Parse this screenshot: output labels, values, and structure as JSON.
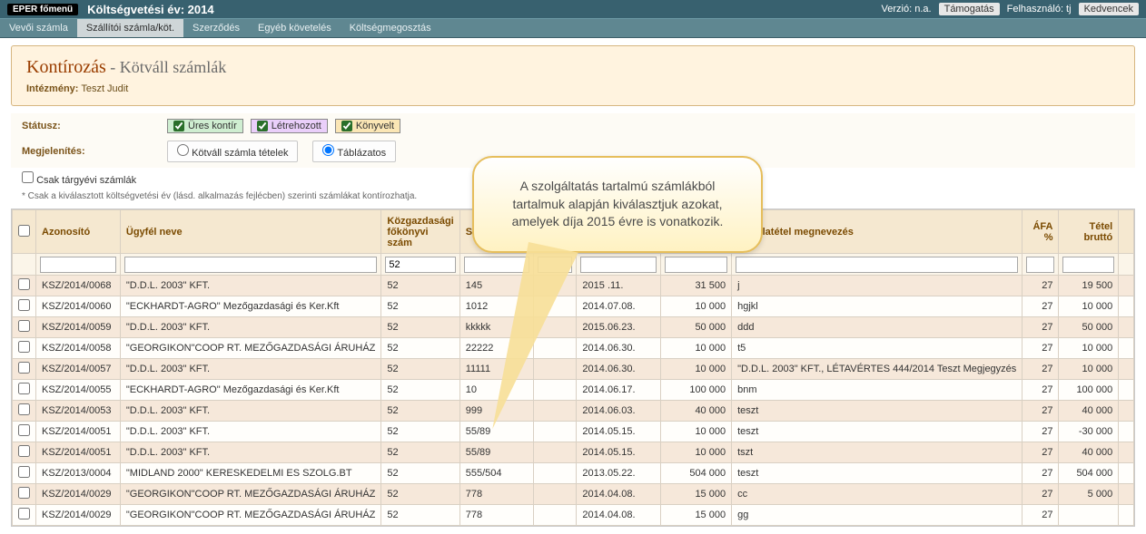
{
  "topbar": {
    "brand": "EPER főmenü",
    "year_label": "Költségvetési év: 2014",
    "verzio": "Verzió: n.a.",
    "tamogatas": "Támogatás",
    "user_label": "Felhasználó: tj",
    "favs": "Kedvencek"
  },
  "menu": [
    "Vevői számla",
    "Szállítói számla/köt.",
    "Szerződés",
    "Egyéb követelés",
    "Költségmegosztás"
  ],
  "panel": {
    "title": "Kontírozás",
    "subtitle": " - Kötváll számlák",
    "inst_label": "Intézmény:",
    "inst_value": "Teszt Judit"
  },
  "filters": {
    "status_label": "Státusz:",
    "st1": "Üres kontír",
    "st2": "Létrehozott",
    "st3": "Könyvelt",
    "display_label": "Megjelenítés:",
    "r1": "Kötváll számla tételek",
    "r2": "Táblázatos",
    "only_this_year": "Csak tárgyévi számlák",
    "note": "* Csak a kiválasztott költségvetési év (lásd. alkalmazás fejlécben) szerinti számlákat kontírozhatja."
  },
  "callout": "A szolgáltatás tartalmú számlákból tartalmuk alapján kiválasztjuk azokat, amelyek díja 2015 évre is vonatkozik.",
  "columns": {
    "id": "Azonosító",
    "client": "Ügyfél neve",
    "fk": "Közgazdasági főkönyvi szám",
    "szs": "Számla so",
    "d1": "",
    "d2": "",
    "num": "",
    "desc": "számlatétel megnevezés",
    "afa": "ÁFA %",
    "brutto": "Tétel bruttó"
  },
  "filter_row": {
    "fk": "52"
  },
  "rows": [
    {
      "id": "KSZ/2014/0068",
      "client": "\"D.D.L. 2003\" KFT.",
      "fk": "52",
      "szs": "145",
      "d1": "",
      "d2": "2015     .11.",
      "num": "31 500",
      "desc": "j",
      "afa": "27",
      "brutto": "19 500"
    },
    {
      "id": "KSZ/2014/0060",
      "client": "\"ECKHARDT-AGRO\" Mezőgazdasági és Ker.Kft",
      "fk": "52",
      "szs": "1012",
      "d1": "",
      "d2": "2014.07.08.",
      "num": "10 000",
      "desc": "hgjkl",
      "afa": "27",
      "brutto": "10 000"
    },
    {
      "id": "KSZ/2014/0059",
      "client": "\"D.D.L. 2003\" KFT.",
      "fk": "52",
      "szs": "kkkkk",
      "d1": "",
      "d2": "2015.06.23.",
      "num": "50 000",
      "desc": "ddd",
      "afa": "27",
      "brutto": "50 000"
    },
    {
      "id": "KSZ/2014/0058",
      "client": "\"GEORGIKON\"COOP RT. MEZŐGAZDASÁGI ÁRUHÁZ",
      "fk": "52",
      "szs": "22222",
      "d1": "",
      "d2": "2014.06.30.",
      "num": "10 000",
      "desc": "t5",
      "afa": "27",
      "brutto": "10 000"
    },
    {
      "id": "KSZ/2014/0057",
      "client": "\"D.D.L. 2003\" KFT.",
      "fk": "52",
      "szs": "11111",
      "d1": "",
      "d2": "2014.06.30.",
      "num": "10 000",
      "desc": "\"D.D.L. 2003\" KFT., LÉTAVÉRTES 444/2014 Teszt Megjegyzés",
      "afa": "27",
      "brutto": "10 000"
    },
    {
      "id": "KSZ/2014/0055",
      "client": "\"ECKHARDT-AGRO\" Mezőgazdasági és Ker.Kft",
      "fk": "52",
      "szs": "10",
      "d1": "",
      "d2": "2014.06.17.",
      "num": "100 000",
      "desc": "bnm",
      "afa": "27",
      "brutto": "100 000"
    },
    {
      "id": "KSZ/2014/0053",
      "client": "\"D.D.L. 2003\" KFT.",
      "fk": "52",
      "szs": "999",
      "d1": "",
      "d2": "2014.06.03.",
      "num": "40 000",
      "desc": "teszt",
      "afa": "27",
      "brutto": "40 000"
    },
    {
      "id": "KSZ/2014/0051",
      "client": "\"D.D.L. 2003\" KFT.",
      "fk": "52",
      "szs": "55/89",
      "d1": "",
      "d2": "2014.05.15.",
      "num": "10 000",
      "desc": "teszt",
      "afa": "27",
      "brutto": "-30 000"
    },
    {
      "id": "KSZ/2014/0051",
      "client": "\"D.D.L. 2003\" KFT.",
      "fk": "52",
      "szs": "55/89",
      "d1": "",
      "d2": "2014.05.15.",
      "num": "10 000",
      "desc": "tszt",
      "afa": "27",
      "brutto": "40 000"
    },
    {
      "id": "KSZ/2013/0004",
      "client": "\"MIDLAND 2000\" KERESKEDELMI ES SZOLG.BT",
      "fk": "52",
      "szs": "555/504",
      "d1": "",
      "d2": "2013.05.22.",
      "num": "504 000",
      "desc": "teszt",
      "afa": "27",
      "brutto": "504 000"
    },
    {
      "id": "KSZ/2014/0029",
      "client": "\"GEORGIKON\"COOP RT. MEZŐGAZDASÁGI ÁRUHÁZ",
      "fk": "52",
      "szs": "778",
      "d1": "",
      "d2": "2014.04.08.",
      "num": "15 000",
      "desc": "cc",
      "afa": "27",
      "brutto": "5 000"
    },
    {
      "id": "KSZ/2014/0029",
      "client": "\"GEORGIKON\"COOP RT. MEZŐGAZDASÁGI ÁRUHÁZ",
      "fk": "52",
      "szs": "778",
      "d1": "",
      "d2": "2014.04.08.",
      "num": "15 000",
      "desc": "gg",
      "afa": "27",
      "brutto": ""
    }
  ]
}
